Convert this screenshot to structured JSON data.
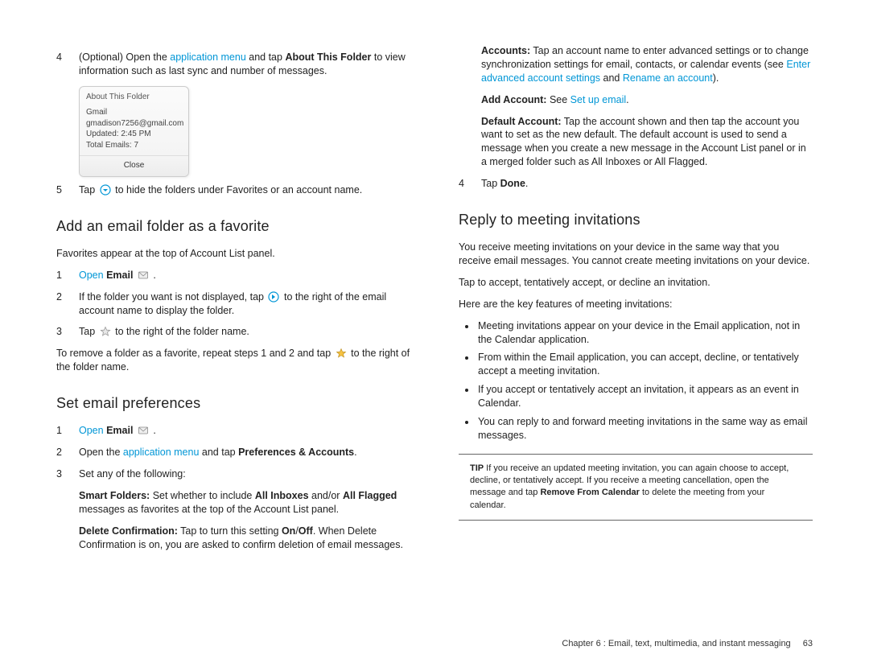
{
  "left": {
    "step4": {
      "num": "4",
      "pre": "(Optional) Open the ",
      "link": "application menu",
      "mid": " and tap ",
      "bold": "About This Folder",
      "post": " to view information such as last sync and number of messages."
    },
    "popup": {
      "title": "About This Folder",
      "l1": "Gmail",
      "l2": "gmadison7256@gmail.com",
      "l3": "Updated: 2:45 PM",
      "l4": "Total Emails: 7",
      "close": "Close"
    },
    "step5": {
      "num": "5",
      "pre": "Tap ",
      "post": " to hide the folders under Favorites or an account name."
    },
    "h_fav": "Add an email folder as a favorite",
    "fav_intro": "Favorites appear at the top of Account List panel.",
    "fav1": {
      "num": "1",
      "open": "Open",
      "email": "Email",
      "dot": " ."
    },
    "fav2": {
      "num": "2",
      "pre": "If the folder you want is not displayed, tap ",
      "post": " to the right of the email account name to display the folder."
    },
    "fav3": {
      "num": "3",
      "pre": "Tap ",
      "post": " to the right of the folder name."
    },
    "fav_remove": {
      "pre": "To remove a folder as a favorite, repeat steps 1 and 2 and tap ",
      "post": " to the right of the folder name."
    },
    "h_pref": "Set email preferences",
    "pref1": {
      "num": "1",
      "open": "Open",
      "email": "Email",
      "dot": " ."
    },
    "pref2": {
      "num": "2",
      "pre": "Open the ",
      "link": "application menu",
      "mid": " and tap ",
      "bold": "Preferences & Accounts",
      "dot": "."
    },
    "pref3": {
      "num": "3",
      "text": "Set any of the following:"
    },
    "smart": {
      "b1": "Smart Folders:",
      "t1": " Set whether to include ",
      "b2": "All Inboxes",
      "t2": " and/or ",
      "b3": "All Flagged",
      "t3": " messages as favorites at the top of the Account List panel."
    },
    "delconf": {
      "b1": "Delete Confirmation:",
      "t1": " Tap to turn this setting ",
      "b2": "On",
      "slash": "/",
      "b3": "Off",
      "t2": ". When Delete Confirmation is on, you are asked to confirm deletion of email messages."
    }
  },
  "right": {
    "accounts": {
      "b": "Accounts:",
      "t1": " Tap an account name to enter advanced settings or to change synchronization settings for email, contacts, or calendar events (see ",
      "link1": "Enter advanced account settings",
      "and": " and ",
      "link2": "Rename an account",
      "end": ")."
    },
    "addacct": {
      "b": "Add Account:",
      "see": " See ",
      "link": "Set up email",
      "dot": "."
    },
    "defacct": {
      "b": "Default Account:",
      "t": " Tap the account shown and then tap the account you want to set as the new default. The default account is used to send a message when you create a new message in the Account List panel or in a merged folder such as All Inboxes or All Flagged."
    },
    "step4b": {
      "num": "4",
      "pre": "Tap ",
      "bold": "Done",
      "dot": "."
    },
    "h_reply": "Reply to meeting invitations",
    "rp1": "You receive meeting invitations on your device in the same way that you receive email messages. You cannot create meeting invitations on your device.",
    "rp2": "Tap to accept, tentatively accept, or decline an invitation.",
    "rp3": "Here are the key features of meeting invitations:",
    "b1": "Meeting invitations appear on your device in the Email application, not in the Calendar application.",
    "b2": "From within the Email application, you can accept, decline, or tentatively accept a meeting invitation.",
    "b3": "If you accept or tentatively accept an invitation, it appears as an event in Calendar.",
    "b4": "You can reply to and forward meeting invitations in the same way as email messages.",
    "tip": {
      "label": "TIP",
      "t1": "  If you receive an updated meeting invitation, you can again choose to accept, decline, or tentatively accept. If you receive a meeting cancellation, open the message and tap ",
      "b": "Remove From Calendar",
      "t2": " to delete the meeting from your calendar."
    }
  },
  "footer": {
    "chapter": "Chapter 6 : Email, text, multimedia, and instant messaging",
    "page": "63"
  }
}
